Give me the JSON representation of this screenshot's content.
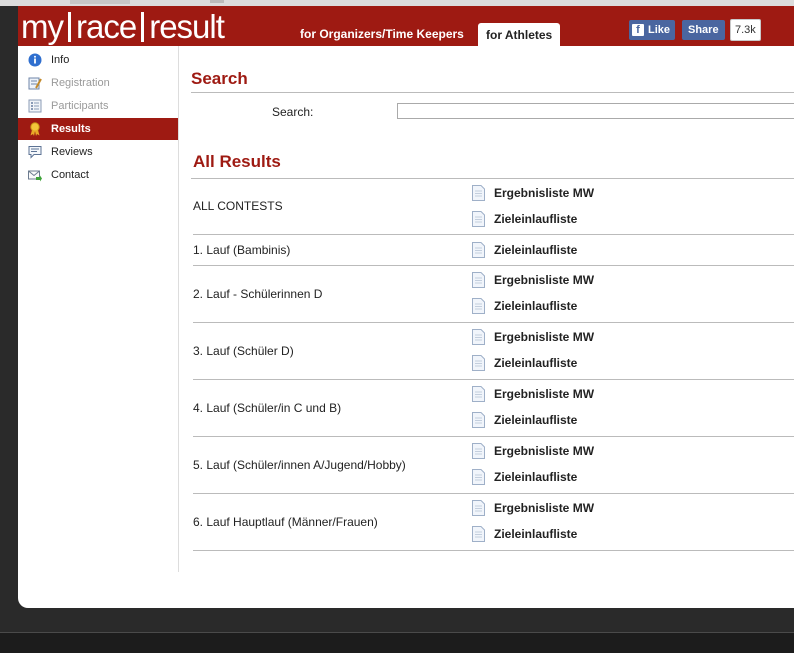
{
  "header": {
    "logo": {
      "part1": "my",
      "part2": "race",
      "part3": "result"
    },
    "nav_organizers": "for Organizers/Time Keepers",
    "nav_athletes": "for Athletes",
    "fb_like": "Like",
    "fb_share": "Share",
    "fb_count": "7.3k"
  },
  "sidebar": {
    "items": [
      {
        "label": "Info",
        "icon": "info-icon",
        "state": "normal"
      },
      {
        "label": "Registration",
        "icon": "registration-icon",
        "state": "disabled"
      },
      {
        "label": "Participants",
        "icon": "participants-icon",
        "state": "disabled"
      },
      {
        "label": "Results",
        "icon": "award-ribbon-icon",
        "state": "active"
      },
      {
        "label": "Reviews",
        "icon": "speech-bubble-icon",
        "state": "normal"
      },
      {
        "label": "Contact",
        "icon": "envelope-icon",
        "state": "normal"
      }
    ]
  },
  "search": {
    "title": "Search",
    "label": "Search:",
    "value": "",
    "placeholder": ""
  },
  "results": {
    "title": "All Results",
    "rows": [
      {
        "contest": "ALL CONTESTS",
        "links": [
          "Ergebnisliste MW",
          "Zieleinlaufliste"
        ]
      },
      {
        "contest": "1. Lauf (Bambinis)",
        "links": [
          "Zieleinlaufliste"
        ]
      },
      {
        "contest": "2. Lauf - Schülerinnen D",
        "links": [
          "Ergebnisliste MW",
          "Zieleinlaufliste"
        ]
      },
      {
        "contest": "3. Lauf (Schüler D)",
        "links": [
          "Ergebnisliste MW",
          "Zieleinlaufliste"
        ]
      },
      {
        "contest": "4. Lauf (Schüler/in C und B)",
        "links": [
          "Ergebnisliste MW",
          "Zieleinlaufliste"
        ]
      },
      {
        "contest": "5. Lauf (Schüler/innen A/Jugend/Hobby)",
        "links": [
          "Ergebnisliste MW",
          "Zieleinlaufliste"
        ]
      },
      {
        "contest": "6. Lauf Hauptlauf (Männer/Frauen)",
        "links": [
          "Ergebnisliste MW",
          "Zieleinlaufliste"
        ]
      }
    ]
  },
  "colors": {
    "brand": "#9e1a12",
    "facebook": "#4a66a0"
  }
}
